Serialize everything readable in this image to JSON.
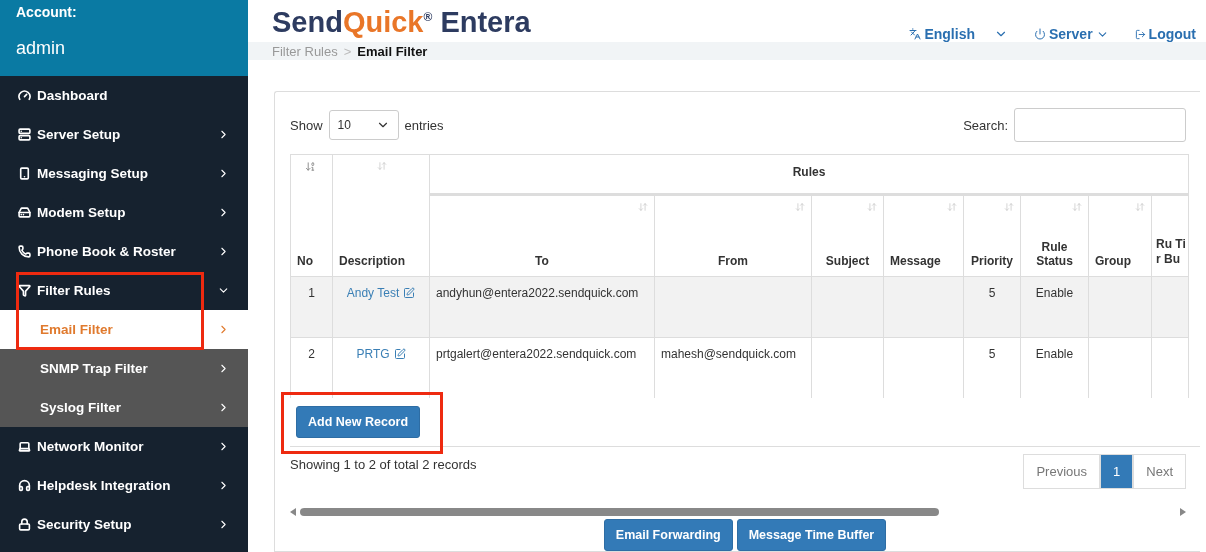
{
  "sidebar": {
    "account_label": "Account:",
    "account_name": "admin",
    "items": [
      {
        "label": "Dashboard",
        "chevron": false
      },
      {
        "label": "Server Setup",
        "chevron": true,
        "expanded": false
      },
      {
        "label": "Messaging Setup",
        "chevron": true,
        "expanded": false
      },
      {
        "label": "Modem Setup",
        "chevron": true,
        "expanded": false
      },
      {
        "label": "Phone Book & Roster",
        "chevron": true,
        "expanded": false
      },
      {
        "label": "Filter Rules",
        "chevron": true,
        "expanded": true,
        "highlighted": true,
        "children": [
          {
            "label": "Email Filter",
            "selected": true
          },
          {
            "label": "SNMP Trap Filter",
            "selected": false
          },
          {
            "label": "Syslog Filter",
            "selected": false
          }
        ]
      },
      {
        "label": "Network Monitor",
        "chevron": true,
        "expanded": false
      },
      {
        "label": "Helpdesk Integration",
        "chevron": true,
        "expanded": false
      },
      {
        "label": "Security Setup",
        "chevron": true,
        "expanded": false
      }
    ]
  },
  "header": {
    "logo": {
      "part_1": "Send",
      "part_2": "Quick",
      "mark": "®",
      "part_3": "Entera"
    },
    "language": "English",
    "server": "Server",
    "logout": "Logout"
  },
  "breadcrumb_separator": ">",
  "breadcrumb": [
    {
      "label": "Filter Rules",
      "current": false
    },
    {
      "label": "Email Filter",
      "current": true
    }
  ],
  "table_controls": {
    "show_label": "Show",
    "page_size": "10",
    "entries_label": "entries",
    "search_label": "Search:"
  },
  "table": {
    "group_heading": "Rules",
    "columns": [
      "No",
      "Description",
      "To",
      "From",
      "Subject",
      "Message",
      "Priority",
      "Rule Status",
      "Group",
      "Ru Tir Bu"
    ],
    "rows": [
      {
        "no": "1",
        "description": "Andy Test",
        "to": "andyhun@entera2022.sendquick.com",
        "from": "",
        "subject": "",
        "message": "",
        "priority": "5",
        "rule_status": "Enable",
        "group": ""
      },
      {
        "no": "2",
        "description": "PRTG",
        "to": "prtgalert@entera2022.sendquick.com",
        "from": "mahesh@sendquick.com",
        "subject": "",
        "message": "",
        "priority": "5",
        "rule_status": "Enable",
        "group": ""
      }
    ]
  },
  "add_button": {
    "label": "Add New Record",
    "highlighted": true
  },
  "info": "Showing 1 to 2 of total 2 records",
  "pagination": [
    {
      "label": "Previous",
      "selected": false
    },
    {
      "label": "1",
      "selected": true
    },
    {
      "label": "Next",
      "selected": false
    }
  ],
  "footer_buttons": [
    "Email Forwarding",
    "Message Time Buffer"
  ]
}
